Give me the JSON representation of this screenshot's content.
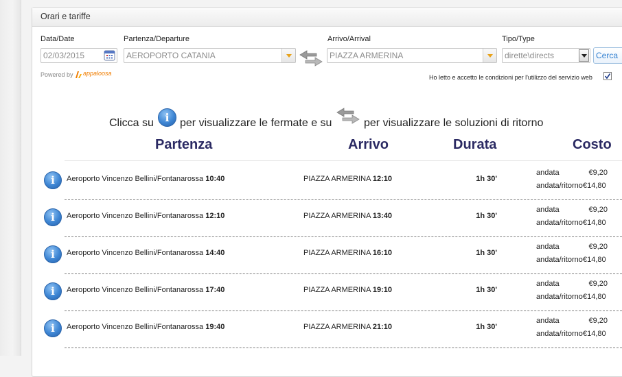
{
  "panel": {
    "title": "Orari e tariffe"
  },
  "form": {
    "date_label": "Data/Date",
    "date_value": "02/03/2015",
    "departure_label": "Partenza/Departure",
    "departure_value": "AEROPORTO CATANIA",
    "arrival_label": "Arrivo/Arrival",
    "arrival_value": "PIAZZA ARMERINA",
    "type_label": "Tipo/Type",
    "type_value": "dirette\\directs",
    "search_button": "Cerca",
    "powered_by": "Powered by",
    "logo_text": "appaloosa",
    "terms_text": "Ho letto e accetto le condizioni per l'utilizzo del servizio web",
    "terms_checked": true
  },
  "info_line": {
    "part1": "Clicca su",
    "part2": "per visualizzare le fermate e su",
    "part3": "per visualizzare le soluzioni di ritorno"
  },
  "columns": {
    "departure": "Partenza",
    "arrival": "Arrivo",
    "duration": "Durata",
    "cost": "Costo"
  },
  "fare_labels": {
    "oneway": "andata",
    "return": "andata/ritorno"
  },
  "rows": [
    {
      "dep_place": "Aeroporto Vincenzo Bellini/Fontanarossa",
      "dep_time": "10:40",
      "arr_place": "PIAZZA ARMERINA",
      "arr_time": "12:10",
      "duration": "1h 30'",
      "oneway": "€9,20",
      "return": "€14,80"
    },
    {
      "dep_place": "Aeroporto Vincenzo Bellini/Fontanarossa",
      "dep_time": "12:10",
      "arr_place": "PIAZZA ARMERINA",
      "arr_time": "13:40",
      "duration": "1h 30'",
      "oneway": "€9,20",
      "return": "€14,80"
    },
    {
      "dep_place": "Aeroporto Vincenzo Bellini/Fontanarossa",
      "dep_time": "14:40",
      "arr_place": "PIAZZA ARMERINA",
      "arr_time": "16:10",
      "duration": "1h 30'",
      "oneway": "€9,20",
      "return": "€14,80"
    },
    {
      "dep_place": "Aeroporto Vincenzo Bellini/Fontanarossa",
      "dep_time": "17:40",
      "arr_place": "PIAZZA ARMERINA",
      "arr_time": "19:10",
      "duration": "1h 30'",
      "oneway": "€9,20",
      "return": "€14,80"
    },
    {
      "dep_place": "Aeroporto Vincenzo Bellini/Fontanarossa",
      "dep_time": "19:40",
      "arr_place": "PIAZZA ARMERINA",
      "arr_time": "21:10",
      "duration": "1h 30'",
      "oneway": "€9,20",
      "return": "€14,80"
    }
  ],
  "icons": {
    "info": "info-icon",
    "swap": "swap-arrows-icon",
    "calendar": "calendar-icon",
    "logo": "appaloosa-logo"
  },
  "colors": {
    "heading": "#2b2a63",
    "info_blue": "#3e86d4",
    "arrow_orange": "#e8a21a",
    "logo_orange": "#f07d00"
  }
}
